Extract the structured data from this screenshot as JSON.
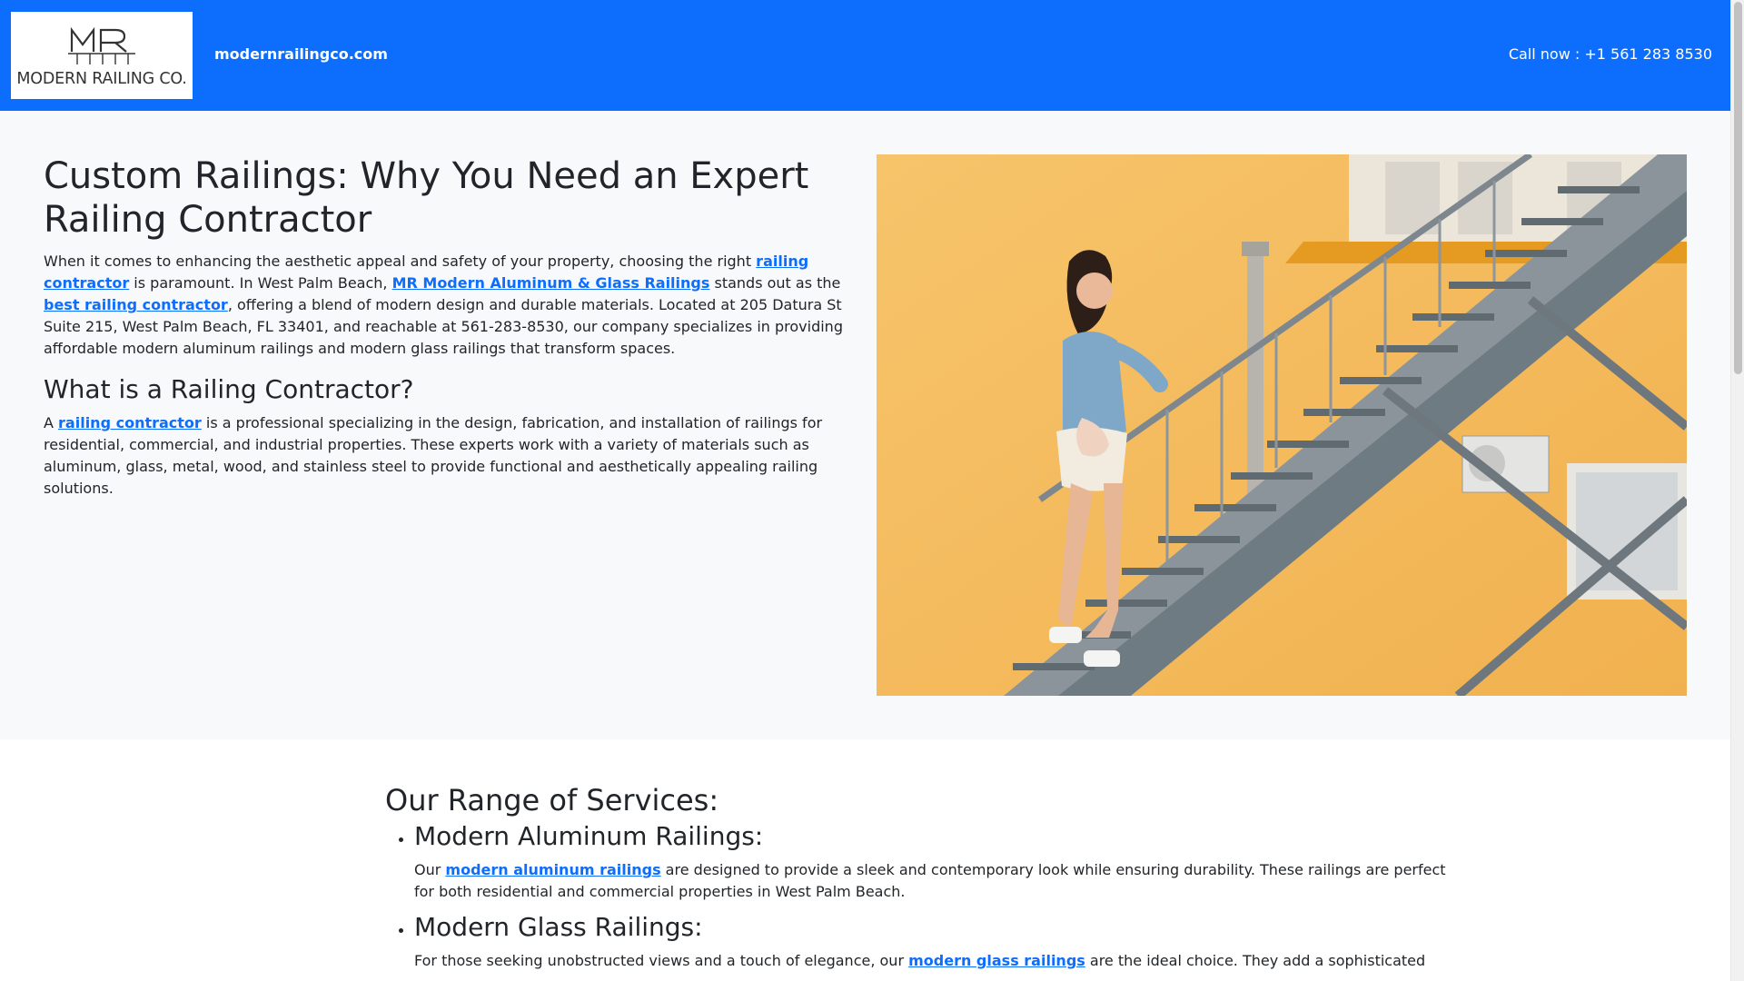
{
  "header": {
    "logo_alt_text": "MODERN RAILING CO.",
    "site_name": "modernrailingco.com",
    "call_now": "Call now : +1 561 283 8530"
  },
  "hero": {
    "title": "Custom Railings: Why You Need an Expert Railing Contractor",
    "intro": {
      "t1": "When it comes to enhancing the aesthetic appeal and safety of your property, choosing the right ",
      "link1": "railing contractor",
      "t2": " is paramount. In West Palm Beach, ",
      "link2": "MR Modern Aluminum & Glass Railings",
      "t3": " stands out as the ",
      "link3": "best railing contractor",
      "t4": ", offering a blend of modern design and durable materials. Located at 205 Datura St Suite 215, West Palm Beach, FL 33401, and reachable at 561-283-8530, our company specializes in providing affordable modern aluminum railings and modern glass railings that transform spaces."
    },
    "what_heading": "What is a Railing Contractor?",
    "what": {
      "t1": "A ",
      "link1": "railing contractor",
      "t2": " is a professional specializing in the design, fabrication, and installation of railings for residential, commercial, and industrial properties. These experts work with a variety of materials such as aluminum, glass, metal, wood, and stainless steel to provide functional and aesthetically appealing railing solutions."
    },
    "image_description": "photo-woman-on-outdoor-metal-staircase"
  },
  "services": {
    "title": "Our Range of Services:",
    "items": [
      {
        "heading": "Modern Aluminum Railings:",
        "t1": "Our ",
        "link": "modern aluminum railings",
        "t2": " are designed to provide a sleek and contemporary look while ensuring durability. These railings are perfect for both residential and commercial properties in West Palm Beach."
      },
      {
        "heading": "Modern Glass Railings:",
        "t1": "For those seeking unobstructed views and a touch of elegance, our ",
        "link": "modern glass railings",
        "t2": " are the ideal choice. They add a sophisticated"
      }
    ]
  },
  "colors": {
    "header_bg": "#0d6efd",
    "link": "#0d6efd",
    "hero_bg": "#f8f9fa",
    "wall": "#f4b95c"
  }
}
